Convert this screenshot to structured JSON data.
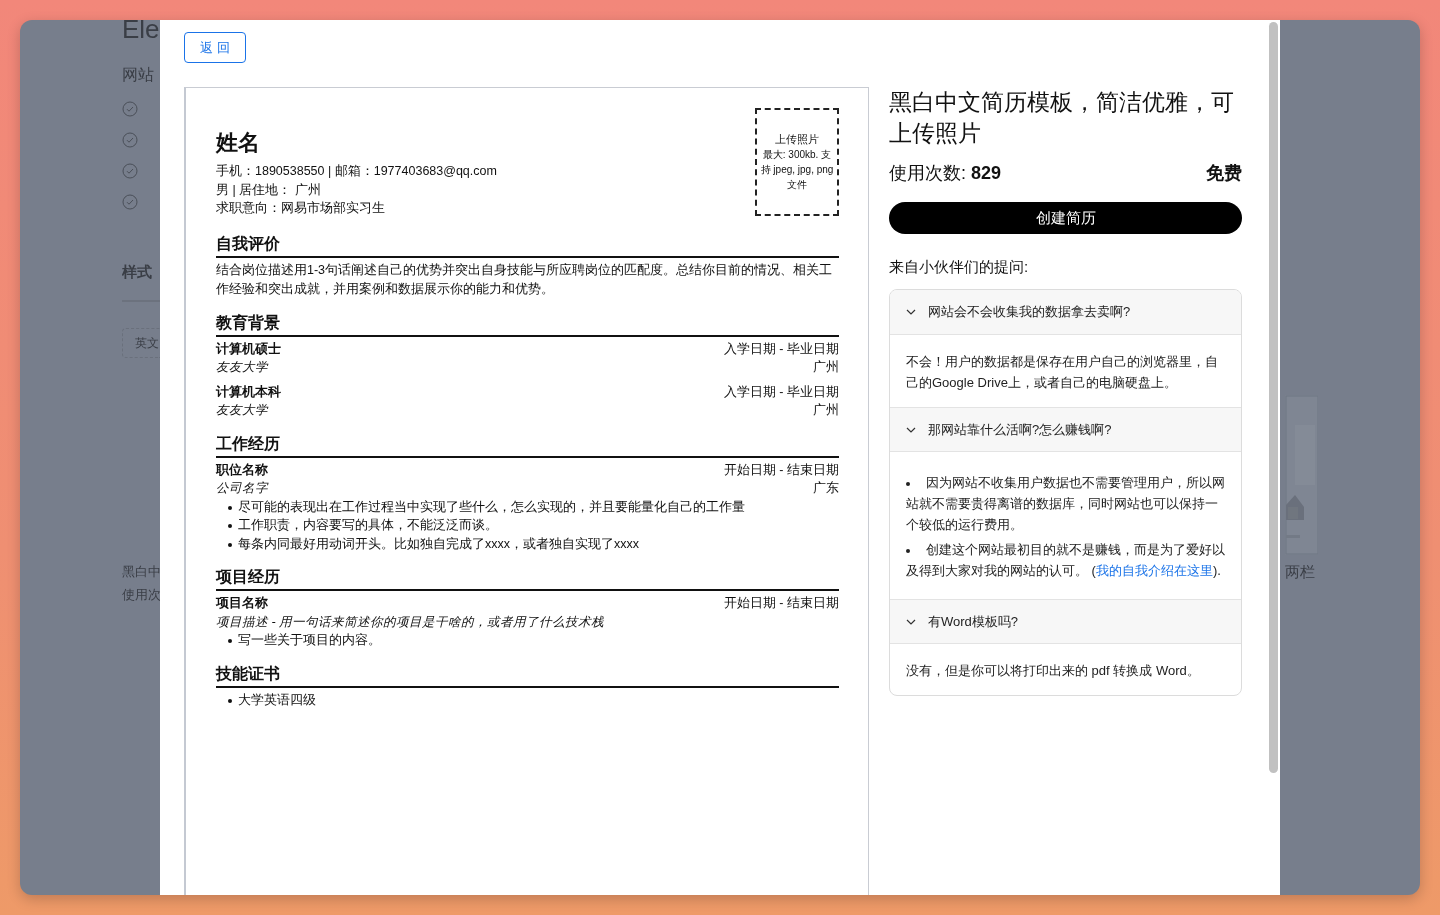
{
  "background_page": {
    "title": "Ele",
    "subtitle": "网站",
    "section_title": "样式",
    "tag": "英文",
    "left_card": {
      "title": "黑白中",
      "meta": "使用次"
    },
    "right_card": {
      "kind": "picture",
      "title": "两栏"
    }
  },
  "modal": {
    "back_button": "返 回",
    "resume": {
      "name": "姓名",
      "contact_lines": [
        "手机：1890538550 | 邮箱：1977403683@qq.com",
        "男 | 居住地：  广州",
        "求职意向：网易市场部实习生"
      ],
      "photo_box": {
        "title": "上传照片",
        "hint": "最大: 300kb. 支持 jpeg, jpg, png 文件"
      },
      "sections": [
        {
          "title": "自我评价",
          "kind": "paragraph",
          "text": "结合岗位描述用1-3句话阐述自己的优势并突出自身技能与所应聘岗位的匹配度。总结你目前的情况、相关工作经验和突出成就，并用案例和数据展示你的能力和优势。"
        },
        {
          "title": "教育背景",
          "kind": "entries",
          "entries": [
            {
              "title": "计算机硕士",
              "date": "入学日期 - 毕业日期",
              "subtitle": "友友大学",
              "location": "广州"
            },
            {
              "title": "计算机本科",
              "date": "入学日期 - 毕业日期",
              "subtitle": "友友大学",
              "location": "广州"
            }
          ]
        },
        {
          "title": "工作经历",
          "kind": "entries",
          "entries": [
            {
              "title": "职位名称",
              "date": "开始日期 - 结束日期",
              "subtitle": "公司名字",
              "location": "广东",
              "bullets": [
                "尽可能的表现出在工作过程当中实现了些什么，怎么实现的，并且要能量化自己的工作量",
                "工作职责，内容要写的具体，不能泛泛而谈。",
                "每条内同最好用动词开头。比如独自完成了xxxx，或者独自实现了xxxx"
              ]
            }
          ]
        },
        {
          "title": "项目经历",
          "kind": "entries",
          "entries": [
            {
              "title": "项目名称",
              "date": "开始日期 - 结束日期",
              "subtitle": "项目描述 - 用一句话来简述你的项目是干啥的，或者用了什么技术栈",
              "bullets": [
                "写一些关于项目的内容。"
              ]
            }
          ]
        },
        {
          "title": "技能证书",
          "kind": "list",
          "items": [
            "大学英语四级"
          ]
        }
      ]
    },
    "panel": {
      "title": "黑白中文简历模板，简洁优雅，可上传照片",
      "usage_label": "使用次数: ",
      "usage_count": "829",
      "price": "免费",
      "create_button": "创建简历",
      "faq_heading": "来自小伙伴们的提问:",
      "faqs": [
        {
          "question": "网站会不会收集我的数据拿去卖啊?",
          "expanded": true,
          "kind": "text",
          "answer": "不会！用户的数据都是保存在用户自己的浏览器里，自己的Google Drive上，或者自己的电脑硬盘上。"
        },
        {
          "question": "那网站靠什么活啊?怎么赚钱啊?",
          "expanded": true,
          "kind": "bullets",
          "answer_items": [
            {
              "text": "因为网站不收集用户数据也不需要管理用户，所以网站就不需要贵得离谱的数据库，同时网站也可以保持一个较低的运行费用。"
            },
            {
              "text": "创建这个网站最初目的就不是赚钱，而是为了爱好以及得到大家对我的网站的认可。 (",
              "link": "我的自我介绍在这里",
              "after": ")."
            }
          ]
        },
        {
          "question": "有Word模板吗?",
          "expanded": true,
          "kind": "text",
          "answer": "没有，但是你可以将打印出来的 pdf 转换成 Word。"
        }
      ]
    }
  }
}
